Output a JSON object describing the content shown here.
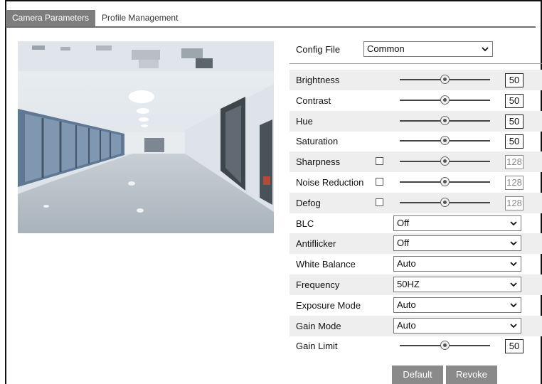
{
  "tabs": [
    {
      "label": "Camera Parameters",
      "active": true
    },
    {
      "label": "Profile Management",
      "active": false
    }
  ],
  "config": {
    "label": "Config File",
    "value": "Common"
  },
  "sliders": [
    {
      "label": "Brightness",
      "value": "50",
      "level": 0.5,
      "checkbox": false,
      "dim": false
    },
    {
      "label": "Contrast",
      "value": "50",
      "level": 0.5,
      "checkbox": false,
      "dim": false
    },
    {
      "label": "Hue",
      "value": "50",
      "level": 0.5,
      "checkbox": false,
      "dim": false
    },
    {
      "label": "Saturation",
      "value": "50",
      "level": 0.5,
      "checkbox": false,
      "dim": false
    },
    {
      "label": "Sharpness",
      "value": "128",
      "level": 0.5,
      "checkbox": true,
      "dim": true
    },
    {
      "label": "Noise Reduction",
      "value": "128",
      "level": 0.5,
      "checkbox": true,
      "dim": true
    },
    {
      "label": "Defog",
      "value": "128",
      "level": 0.5,
      "checkbox": true,
      "dim": true
    }
  ],
  "selects": [
    {
      "label": "BLC",
      "value": "Off"
    },
    {
      "label": "Antiflicker",
      "value": "Off"
    },
    {
      "label": "White Balance",
      "value": "Auto"
    },
    {
      "label": "Frequency",
      "value": "50HZ"
    },
    {
      "label": "Exposure Mode",
      "value": "Auto"
    },
    {
      "label": "Gain Mode",
      "value": "Auto"
    }
  ],
  "gain_limit": {
    "label": "Gain Limit",
    "value": "50",
    "level": 0.5
  },
  "buttons": {
    "default": "Default",
    "revoke": "Revoke"
  },
  "icons": {
    "dropdown": "chevron-down-icon",
    "checkbox": "checkbox-icon",
    "slider": "slider-knob-icon"
  }
}
